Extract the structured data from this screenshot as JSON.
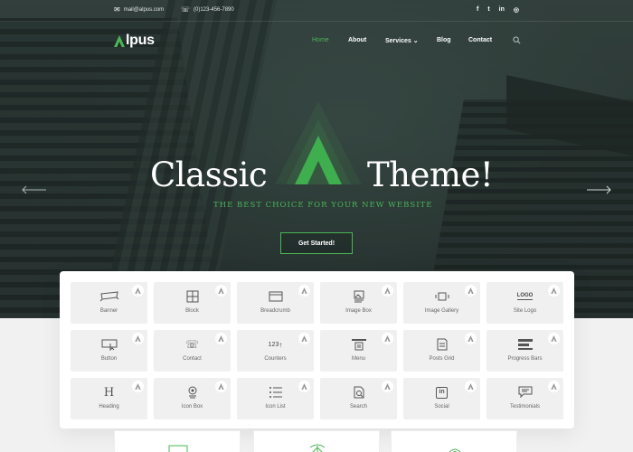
{
  "topbar": {
    "email": "mail@alpus.com",
    "phone": "(0)123-456-7890",
    "social": [
      {
        "icon": "facebook-icon",
        "glyph": "f"
      },
      {
        "icon": "twitter-icon",
        "glyph": "t"
      },
      {
        "icon": "linkedin-icon",
        "glyph": "in"
      },
      {
        "icon": "instagram-icon",
        "glyph": "◎"
      }
    ]
  },
  "brand": {
    "name": "lpus",
    "accent": "#4cb556"
  },
  "nav": {
    "home": "Home",
    "about": "About",
    "services": "Services",
    "blog": "Blog",
    "contact": "Contact"
  },
  "hero": {
    "title_left": "Classic",
    "title_right": "Theme!",
    "subtitle": "THE BEST CHOICE FOR YOUR NEW WEBSITE",
    "cta": "Get Started!"
  },
  "widgets": [
    {
      "label": "Banner",
      "icon": "banner-icon"
    },
    {
      "label": "Block",
      "icon": "block-icon"
    },
    {
      "label": "Breadcrumb",
      "icon": "breadcrumb-icon"
    },
    {
      "label": "Image Box",
      "icon": "image-box-icon"
    },
    {
      "label": "Image Gallery",
      "icon": "image-gallery-icon"
    },
    {
      "label": "Site Logo",
      "icon": "site-logo-icon"
    },
    {
      "label": "Button",
      "icon": "button-icon"
    },
    {
      "label": "Contact",
      "icon": "contact-phone-icon"
    },
    {
      "label": "Counters",
      "icon": "counters-icon"
    },
    {
      "label": "Menu",
      "icon": "menu-icon"
    },
    {
      "label": "Posts Grid",
      "icon": "posts-grid-icon"
    },
    {
      "label": "Progress Bars",
      "icon": "progress-bars-icon"
    },
    {
      "label": "Heading",
      "icon": "heading-icon"
    },
    {
      "label": "Icon Box",
      "icon": "icon-box-icon"
    },
    {
      "label": "Icon List",
      "icon": "icon-list-icon"
    },
    {
      "label": "Search",
      "icon": "search-doc-icon"
    },
    {
      "label": "Social",
      "icon": "social-linkedin-icon"
    },
    {
      "label": "Testimonials",
      "icon": "testimonials-icon"
    }
  ],
  "icon_text": {
    "logo": "LOGO",
    "counter": "123",
    "heading": "H",
    "linkedin": "in"
  }
}
